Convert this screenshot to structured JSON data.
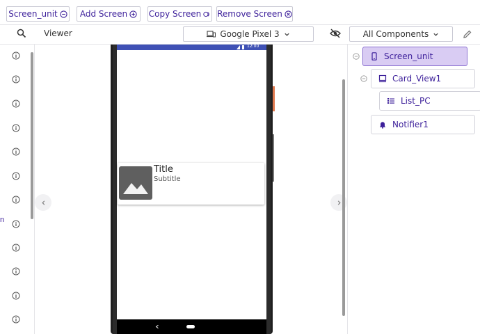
{
  "toolbar": {
    "screen_unit": "Screen_unit",
    "add_screen": "Add Screen",
    "copy_screen": "Copy Screen",
    "remove_screen": "Remove Screen"
  },
  "viewer": {
    "label": "Viewer",
    "device": "Google Pixel 3",
    "status_time": "12:00"
  },
  "palette": {
    "cut_text": "n"
  },
  "card": {
    "title": "Title",
    "subtitle": "Subtitle"
  },
  "components": {
    "filter": "All Components",
    "items": [
      {
        "label": "Screen_unit",
        "icon": "phone-icon"
      },
      {
        "label": "Card_View1",
        "icon": "card-icon"
      },
      {
        "label": "List_PC",
        "icon": "list-icon"
      },
      {
        "label": "Notifier1",
        "icon": "bell-icon"
      }
    ]
  },
  "colors": {
    "accent": "#3c1f9a",
    "selected": "#d9ccf3",
    "statusbar": "#3f51b5"
  }
}
